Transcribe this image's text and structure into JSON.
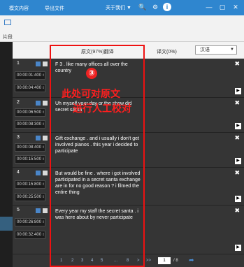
{
  "topbar": {
    "tab1": "模文内容",
    "tab2": "导出文件",
    "about": "关于我们 ▼",
    "search_icon": "🔍",
    "gear_icon": "⚙",
    "info_icon": "i",
    "min": "—",
    "max": "▢",
    "close": "✕"
  },
  "subheader": {
    "label": "片段"
  },
  "columns": {
    "source": "原文(97%)翻译",
    "target": "译文(0%)",
    "lang": "汉语"
  },
  "rows": [
    {
      "num": "1",
      "t1": "00:00:01:400",
      "t2": "00:00:04:400",
      "text": "F 3 . like many offices all over the country"
    },
    {
      "num": "2",
      "t1": "00:00:06:500",
      "t2": "00:00:08:300",
      "text": "Uh myself your day or the show did secret santa"
    },
    {
      "num": "3",
      "t1": "00:00:08:400",
      "t2": "00:00:15:500",
      "text": "Gift exchange . and i usually i don't get involved pianos . this year i decided to participate"
    },
    {
      "num": "4",
      "t1": "00:00:15:800",
      "t2": "00:00:25:500",
      "text": "But would be fine . where i got involved participated in a secret santa exchange are in for no good reason ? i filmed the entire thing"
    },
    {
      "num": "5",
      "t1": "00:00:26:800",
      "t2": "00:00:32:400",
      "text": "Every year my staff the secret santa . i was here about by never participate"
    }
  ],
  "annotation": {
    "marker": "③",
    "line1": "此处可对原文",
    "line2": "进行人工校对"
  },
  "pager": {
    "pages": [
      "1",
      "2",
      "3",
      "4",
      "5",
      "...",
      "8",
      ">",
      ">>"
    ],
    "current": "1",
    "total": "/ 8"
  }
}
